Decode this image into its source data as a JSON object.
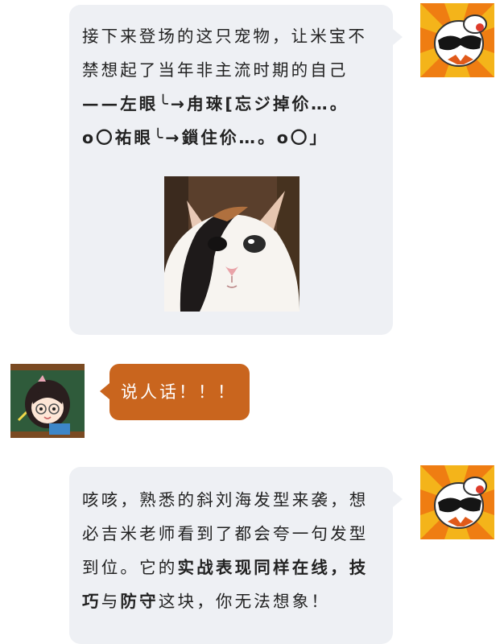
{
  "messages": [
    {
      "lines": [
        "接下来登场的这只宠物，让米宝不",
        "禁想起了当年非主流时期的自己",
        "——左眼╰→甪琜[忘ジ掉伱…。",
        "o〇祐眼╰→鎻住伱…。o〇」"
      ]
    },
    {
      "text": "说人话！！！"
    },
    {
      "parts": [
        "咳咳，熟悉的斜刘海发型来袭，想必吉米老师看到了都会夸一句发型到位。它的",
        "实战表现同样在线，技巧",
        "与",
        "防守",
        "这块，你无法想象！"
      ]
    }
  ],
  "colors": {
    "bubble_light": "#eef0f4",
    "bubble_orange": "#c9651e"
  }
}
